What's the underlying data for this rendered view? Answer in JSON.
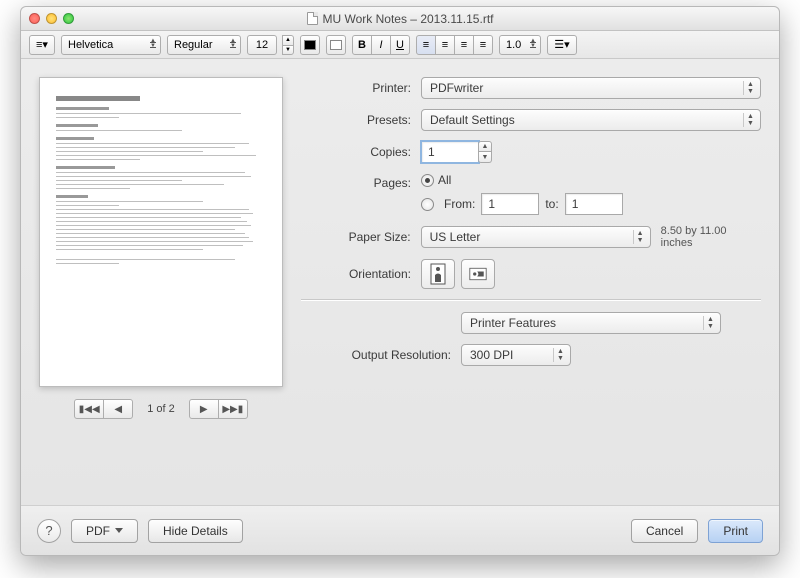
{
  "window": {
    "title": "MU Work Notes – 2013.11.15.rtf"
  },
  "toolbar": {
    "font": "Helvetica",
    "weight": "Regular",
    "size": "12",
    "color_fg": "#000000",
    "color_bg": "#ffffff",
    "spacing": "1.0"
  },
  "preview": {
    "page_label": "1 of 2"
  },
  "labels": {
    "printer": "Printer:",
    "presets": "Presets:",
    "copies": "Copies:",
    "pages": "Pages:",
    "all": "All",
    "from": "From:",
    "to": "to:",
    "paper_size": "Paper Size:",
    "orientation": "Orientation:",
    "output_resolution": "Output Resolution:"
  },
  "print": {
    "printer": "PDFwriter",
    "preset": "Default Settings",
    "copies": "1",
    "pages_mode": "all",
    "from": "1",
    "to": "1",
    "paper_size": "US Letter",
    "paper_dims": "8.50 by 11.00 inches",
    "section": "Printer Features",
    "output_resolution": "300 DPI"
  },
  "footer": {
    "help": "?",
    "pdf": "PDF",
    "hide_details": "Hide Details",
    "cancel": "Cancel",
    "print": "Print"
  }
}
